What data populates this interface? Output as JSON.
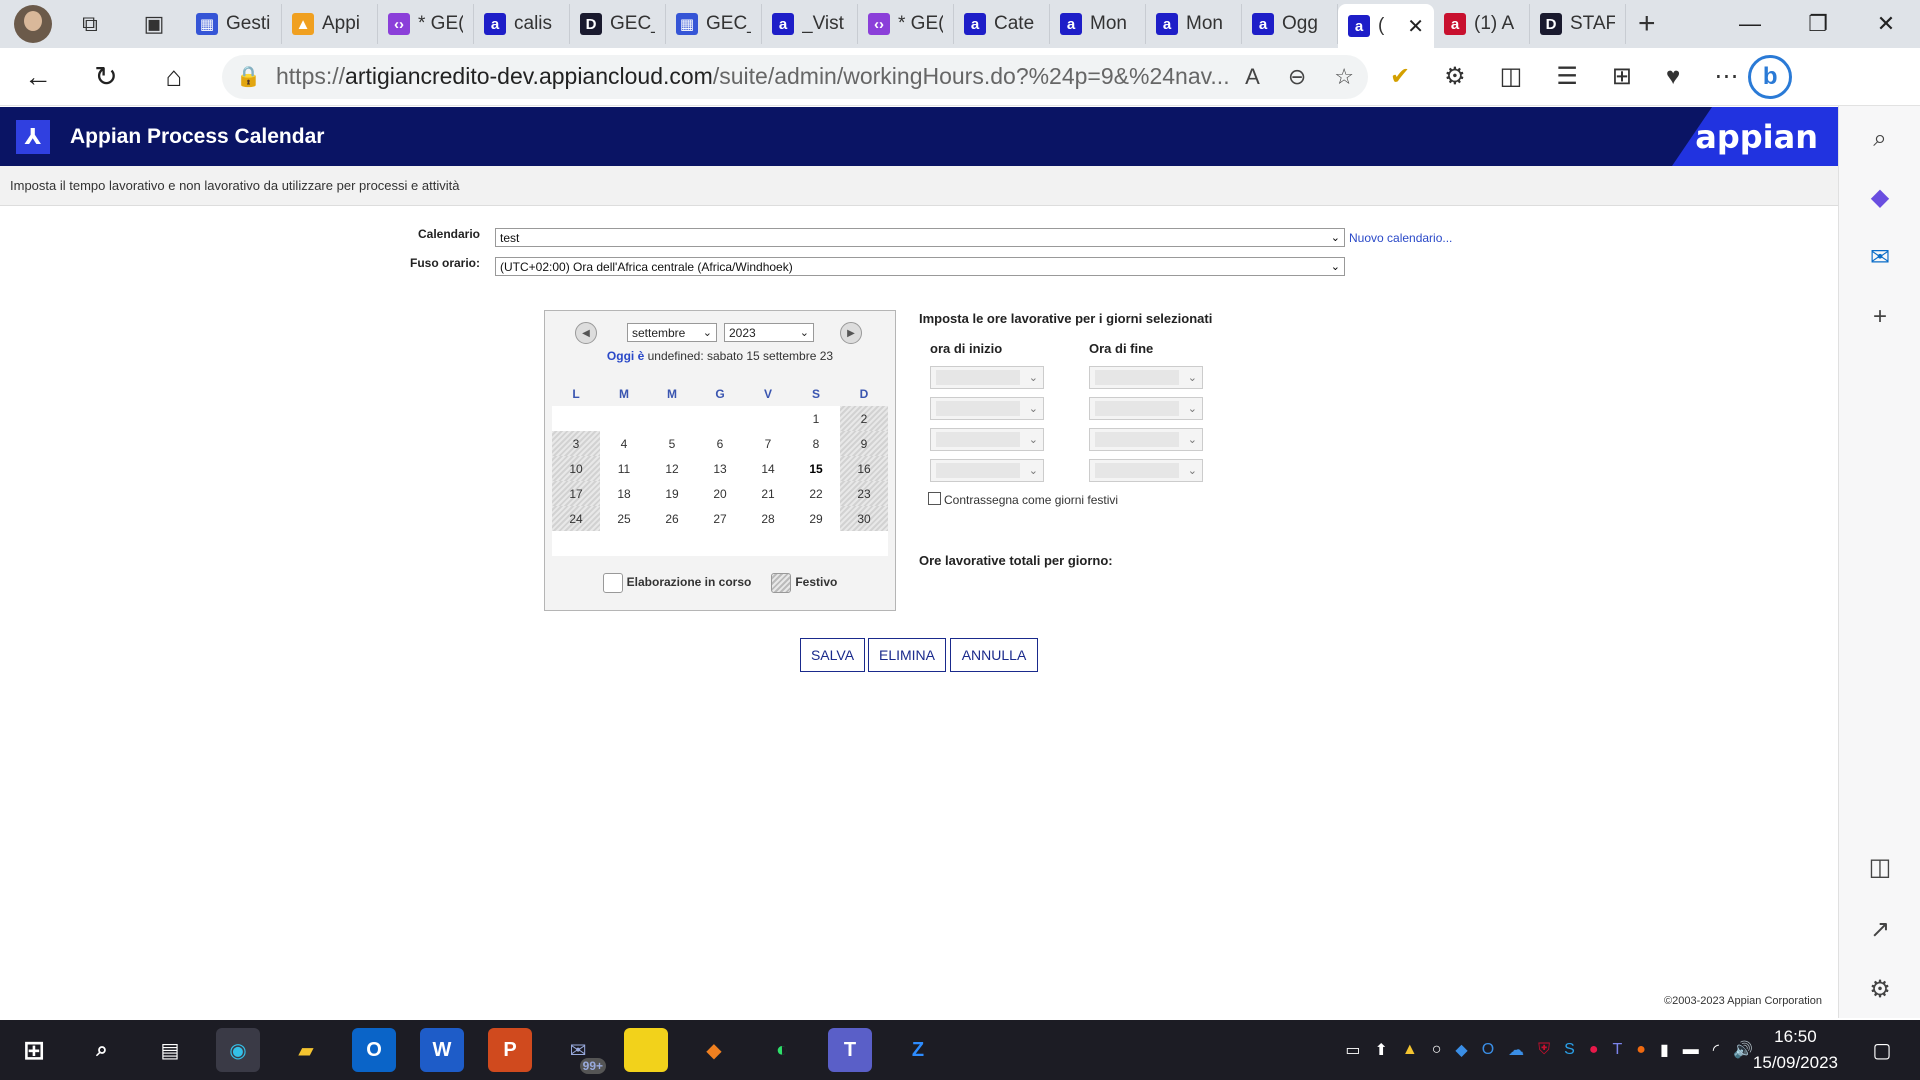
{
  "browser": {
    "tabs": [
      {
        "label": "Gesti",
        "icon": "grid"
      },
      {
        "label": "Appi",
        "icon": "pma"
      },
      {
        "label": "* GE(",
        "icon": "code"
      },
      {
        "label": "calis",
        "icon": "appian"
      },
      {
        "label": "GEC_",
        "icon": "dark"
      },
      {
        "label": "GEC_",
        "icon": "grid"
      },
      {
        "label": "_Vist",
        "icon": "appian"
      },
      {
        "label": "* GE(",
        "icon": "code"
      },
      {
        "label": "Cate",
        "icon": "appian"
      },
      {
        "label": "Mon",
        "icon": "appian"
      },
      {
        "label": "Mon",
        "icon": "appian"
      },
      {
        "label": "Ogg",
        "icon": "appian"
      },
      {
        "label": "(",
        "icon": "appian",
        "active": true
      },
      {
        "label": "(1) A",
        "icon": "red"
      },
      {
        "label": "STAF",
        "icon": "dark"
      }
    ],
    "address": {
      "scheme": "https://",
      "host": "artigiancredito-dev.appiancloud.com",
      "path": "/suite/admin/workingHours.do?%24p=9&%24nav..."
    }
  },
  "app": {
    "title": "Appian Process Calendar",
    "brand": "appian",
    "subtitle": "Imposta il tempo lavorativo e non lavorativo da utilizzare per processi e attività"
  },
  "form": {
    "calendar_label": "Calendario",
    "calendar_value": "test",
    "new_calendar_link": "Nuovo calendario...",
    "timezone_label": "Fuso orario:",
    "timezone_value": "(UTC+02:00) Ora dell'Africa centrale (Africa/Windhoek)"
  },
  "calendar": {
    "month": "settembre",
    "year": "2023",
    "today_prefix": "Oggi",
    "today_verb": "è",
    "today_text": "undefined: sabato 15 settembre 23",
    "weekdays": [
      "L",
      "M",
      "M",
      "G",
      "V",
      "S",
      "D"
    ],
    "weeks": [
      [
        "",
        "",
        "",
        "",
        "",
        "1",
        "2"
      ],
      [
        "3",
        "4",
        "5",
        "6",
        "7",
        "8",
        "9"
      ],
      [
        "10",
        "11",
        "12",
        "13",
        "14",
        "15",
        "16"
      ],
      [
        "17",
        "18",
        "19",
        "20",
        "21",
        "22",
        "23"
      ],
      [
        "24",
        "25",
        "26",
        "27",
        "28",
        "29",
        "30"
      ],
      [
        "",
        "",
        "",
        "",
        "",
        "",
        ""
      ]
    ],
    "today_day": "15",
    "legend_processing": "Elaborazione in corso",
    "legend_holiday": "Festivo"
  },
  "hours": {
    "title": "Imposta le ore lavorative per i giorni selezionati",
    "start_header": "ora di inizio",
    "end_header": "Ora di fine",
    "holiday_checkbox": "Contrassegna come giorni festivi",
    "total_label": "Ore lavorative totali per giorno:"
  },
  "buttons": {
    "save": "SALVA",
    "delete": "ELIMINA",
    "cancel": "ANNULLA"
  },
  "footer": {
    "copyright": "©2003-2023 Appian Corporation"
  },
  "taskbar": {
    "badge": "99+",
    "time": "16:50",
    "date": "15/09/2023"
  }
}
